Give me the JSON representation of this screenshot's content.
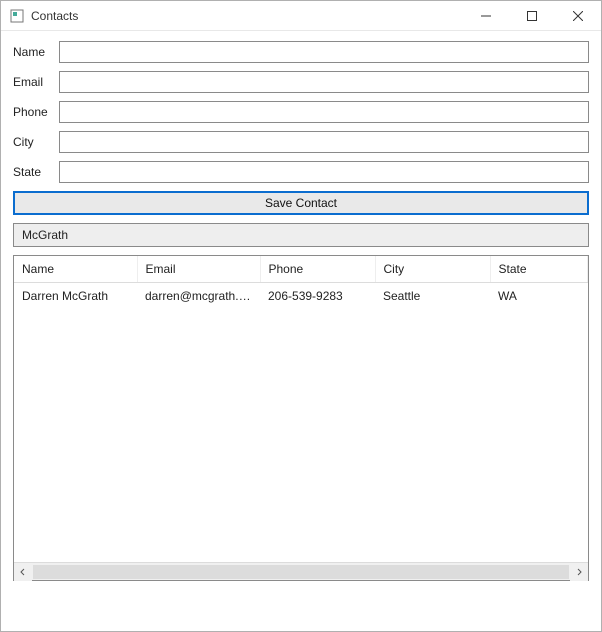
{
  "window": {
    "title": "Contacts"
  },
  "form": {
    "labels": {
      "name": "Name",
      "email": "Email",
      "phone": "Phone",
      "city": "City",
      "state": "State"
    },
    "values": {
      "name": "",
      "email": "",
      "phone": "",
      "city": "",
      "state": ""
    }
  },
  "save_button_label": "Save Contact",
  "search": {
    "value": "McGrath"
  },
  "table": {
    "columns": [
      "Name",
      "Email",
      "Phone",
      "City",
      "State"
    ],
    "rows": [
      {
        "name": "Darren McGrath",
        "email": "darren@mcgrath.c...",
        "phone": "206-539-9283",
        "city": "Seattle",
        "state": "WA"
      }
    ]
  }
}
